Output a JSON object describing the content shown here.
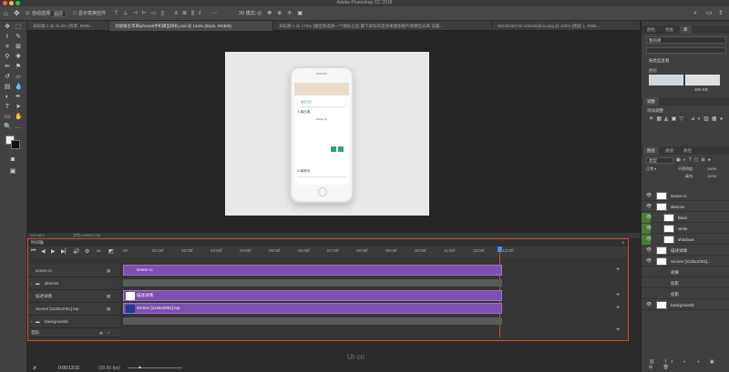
{
  "window": {
    "title": "Adobe Photoshop CC 2018"
  },
  "options_bar": {
    "auto_select_label": "自动选择:",
    "auto_select_value": "图层",
    "show_transform_label": "显示变换控件",
    "mode_3d_label": "3D 模式:"
  },
  "doc_tabs": [
    {
      "label": "未标题-1 @ 41.8% (背景, RGB/..."
    },
    {
      "label": "功能做主苹果iphone8手机模型样机.psd @ 144% (black, RGB/8)",
      "active": true
    },
    {
      "label": "未标题-1 @ 173% (输出到选择一个能标之前,摩下屏标的是效果图加图片到哪出去来,设置..."
    },
    {
      "label": "WX20190730-103445@2x.png @ 100% (图层 1, RGB..."
    }
  ],
  "phone_screen": {
    "header": "首页日历",
    "section1": "人事日报",
    "month": "2019年7月",
    "section2": "人事资讯"
  },
  "status_bar": {
    "zoom": "143.98%",
    "doc_info": "文档:14/M/23.2M"
  },
  "timeline": {
    "panel_title": "时间轴",
    "time_code": "0:00:13:11",
    "fps": "(30.00 fps)",
    "ruler_ticks": [
      "00",
      "01:00f",
      "02:00f",
      "03:00f",
      "04:00f",
      "05:00f",
      "06:00f",
      "07:00f",
      "08:00f",
      "09:00f",
      "10:00f",
      "11:00f",
      "12:00f",
      "13:00f"
    ],
    "tracks": [
      {
        "name": "scene cc",
        "clip": "scene cc",
        "type": "video"
      },
      {
        "name": "devices",
        "clip": "",
        "type": "folder"
      },
      {
        "name": "描述详情",
        "clip": "描述详情",
        "type": "video"
      },
      {
        "name": "Screen [1125x2001] top",
        "clip": "Screen [1125x2001] top",
        "type": "video"
      },
      {
        "name": "backgrounds",
        "clip": "",
        "type": "folder"
      },
      {
        "name": "音轨",
        "clip": "",
        "type": "audio"
      }
    ]
  },
  "right_panel": {
    "top_tabs": [
      "颜色",
      "色板",
      "库"
    ],
    "library_name": "我的库",
    "view_by": "按类型查看",
    "graphics_label": "图形",
    "graphics_size": "300 KB",
    "adjust_label": "调整",
    "add_adjust": "添加调整",
    "layers_tabs": [
      "图层",
      "通道",
      "路径"
    ],
    "kind_label": "类型",
    "opacity_label": "不透明度:",
    "opacity_value": "100%",
    "fill_label": "填充:",
    "fill_value": "100%",
    "layers": [
      {
        "name": "scene cc",
        "indent": 0,
        "green": false
      },
      {
        "name": "devices",
        "indent": 0,
        "green": false
      },
      {
        "name": "black",
        "indent": 1,
        "green": true
      },
      {
        "name": "white",
        "indent": 1,
        "green": true
      },
      {
        "name": "shadows",
        "indent": 1,
        "green": true
      },
      {
        "name": "描述详情",
        "indent": 0,
        "green": false
      },
      {
        "name": "Screen [1125x2001]...",
        "indent": 0,
        "green": false
      },
      {
        "name": "效果",
        "indent": 2,
        "green": false
      },
      {
        "name": "投影",
        "indent": 2,
        "green": false
      },
      {
        "name": "投影",
        "indent": 2,
        "green": false
      },
      {
        "name": "backgrounds",
        "indent": 0,
        "green": false
      }
    ]
  },
  "watermark": "UI·cn"
}
